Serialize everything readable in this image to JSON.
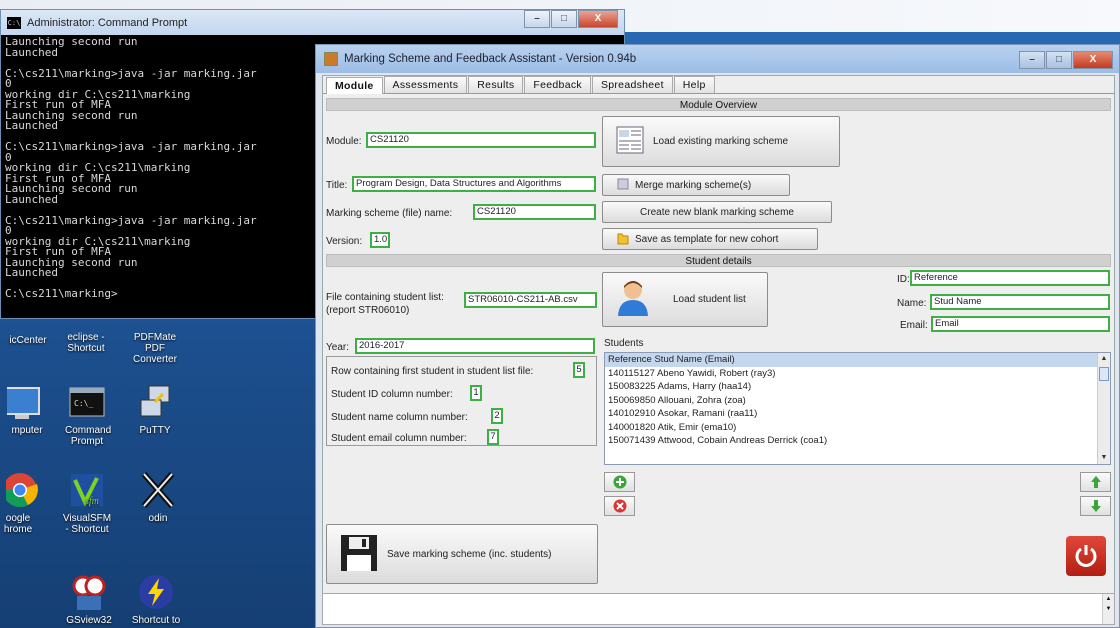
{
  "cmd_window": {
    "title": "Administrator: Command Prompt",
    "buttons": {
      "minimize": "–",
      "maximize": "□",
      "close": "X"
    },
    "lines": [
      "Launching second run",
      "Launched",
      "",
      "C:\\cs211\\marking>java -jar marking.jar",
      "0",
      "working dir C:\\cs211\\marking",
      "First run of MFA",
      "Launching second run",
      "Launched",
      "",
      "C:\\cs211\\marking>java -jar marking.jar",
      "0",
      "working dir C:\\cs211\\marking",
      "First run of MFA",
      "Launching second run",
      "Launched",
      "",
      "C:\\cs211\\marking>java -jar marking.jar",
      "0",
      "working dir C:\\cs211\\marking",
      "First run of MFA",
      "Launching second run",
      "Launched",
      "",
      "C:\\cs211\\marking>"
    ]
  },
  "desktop_icons": [
    {
      "label": "icCenter",
      "icon": "app-icon"
    },
    {
      "label": "eclipse - Shortcut",
      "icon": "eclipse-icon"
    },
    {
      "label": "PDFMate PDF Converter",
      "icon": "pdf-icon"
    },
    {
      "label": "mputer",
      "icon": "computer-icon"
    },
    {
      "label": "Command Prompt",
      "icon": "command-prompt-icon"
    },
    {
      "label": "PuTTY",
      "icon": "putty-icon"
    },
    {
      "label": "oogle hrome",
      "icon": "chrome-icon"
    },
    {
      "label": "VisualSFM - Shortcut",
      "icon": "visualsfm-icon"
    },
    {
      "label": "odin",
      "icon": "odin-icon"
    },
    {
      "label": "GSview32",
      "icon": "gsview-icon"
    },
    {
      "label": "Shortcut to",
      "icon": "lightning-icon"
    }
  ],
  "app": {
    "title": "Marking Scheme and Feedback Assistant - Version 0.94b",
    "buttons": {
      "minimize": "–",
      "maximize": "□",
      "close": "X"
    },
    "tabs": [
      "Module",
      "Assessments",
      "Results",
      "Feedback",
      "Spreadsheet",
      "Help"
    ],
    "module_overview": {
      "header": "Module Overview",
      "module_label": "Module:",
      "module_value": "CS21120",
      "title_label": "Title:",
      "title_value": "Program Design, Data Structures and Algorithms",
      "scheme_label": "Marking scheme (file) name:",
      "scheme_value": "CS21120",
      "version_label": "Version:",
      "version_value": "1.0",
      "load_existing": "Load existing marking scheme",
      "merge": "Merge marking scheme(s)",
      "create_blank": "Create new blank marking scheme",
      "save_template": "Save as template for new cohort"
    },
    "student_details": {
      "header": "Student details",
      "file_label_1": "File containing student list:",
      "file_label_2": "(report STR06010)",
      "file_value": "STR06010-CS211-AB.csv",
      "load_student_list": "Load student list",
      "id_label": "ID:",
      "id_value": "Reference",
      "name_label": "Name:",
      "name_value": "Stud Name",
      "email_label": "Email:",
      "email_value": "Email",
      "year_label": "Year:",
      "year_value": "2016-2017",
      "students_label": "Students",
      "row_first_label": "Row containing first student in student list file:",
      "row_first_value": "5",
      "id_col_label": "Student ID column number:",
      "id_col_value": "1",
      "name_col_label": "Student name column number:",
      "name_col_value": "2",
      "email_col_label": "Student email column number:",
      "email_col_value": "7",
      "list_header": "Reference  Stud Name (Email)",
      "students": [
        "140115127  Abeno Yawidi, Robert (ray3)",
        "150083225  Adams, Harry (haa14)",
        "150069850  Allouani, Zohra (zoa)",
        "140102910  Asokar, Ramani (raa11)",
        "140001820  Atik, Emir (ema10)",
        "150071439  Attwood, Cobain Andreas Derrick (coa1)"
      ]
    },
    "save_button": "Save marking scheme (inc. students)"
  },
  "colors": {
    "field_border": "#3cb043",
    "list_header": "#c5d6ef",
    "power_button": "#c8281e"
  }
}
